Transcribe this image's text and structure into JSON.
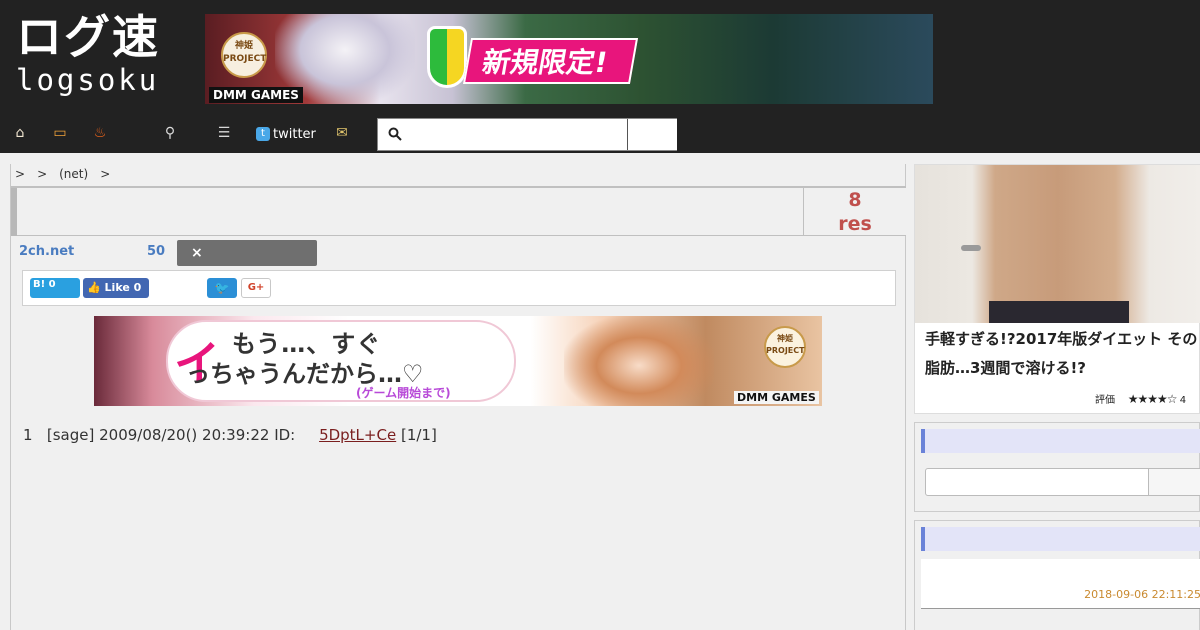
{
  "header": {
    "logo_main": "ログ速",
    "logo_sub": "logsoku",
    "banner": {
      "promo_text": "新規限定!",
      "badge_text": "神姫 PROJECT",
      "brand": "DMM GAMES"
    }
  },
  "nav": {
    "icons": [
      "home-icon",
      "tv-icon",
      "fire-icon",
      "magnifier-icon",
      "list-icon",
      "mail-icon"
    ],
    "twitter_label": "twitter",
    "search": {
      "value": "",
      "placeholder": ""
    }
  },
  "breadcrumb": [
    ">",
    ">",
    "(net)",
    ">"
  ],
  "thread": {
    "title": "",
    "res_count": "8",
    "res_label": "res",
    "board": "2ch.net",
    "count": "50",
    "close_label": "×"
  },
  "share": {
    "hatena_label": "B!",
    "hatena_count": "0",
    "fb_label": "Like",
    "fb_count": "0",
    "gplus_label": "G+"
  },
  "mid_banner": {
    "line1": "もう…、すぐ",
    "big_char": "イ",
    "line2": "っちゃうんだから…♡",
    "sub": "(ゲーム開始まで)",
    "badge_text": "神姫 PROJECT",
    "brand": "DMM GAMES"
  },
  "post": {
    "number": "1",
    "tag": "[sage]",
    "datetime": "2009/08/20() 20:39:22",
    "id_label": "ID:",
    "id_value": "5DptL+Ce",
    "count": "[1/1]"
  },
  "sidebar": {
    "ad_title": "手軽すぎる!?2017年版ダイエット その脂肪…3週間で溶ける!?",
    "rating_label": "評価",
    "rating_value": 4.5,
    "rating_text": "4",
    "widget_date": "2018-09-06 22:11:25"
  },
  "colors": {
    "header_bg": "#222222",
    "accent_red": "#c0504d",
    "link_blue": "#4a7cc0",
    "widget_accent": "#6a82d8",
    "date_orange": "#c98a30"
  }
}
